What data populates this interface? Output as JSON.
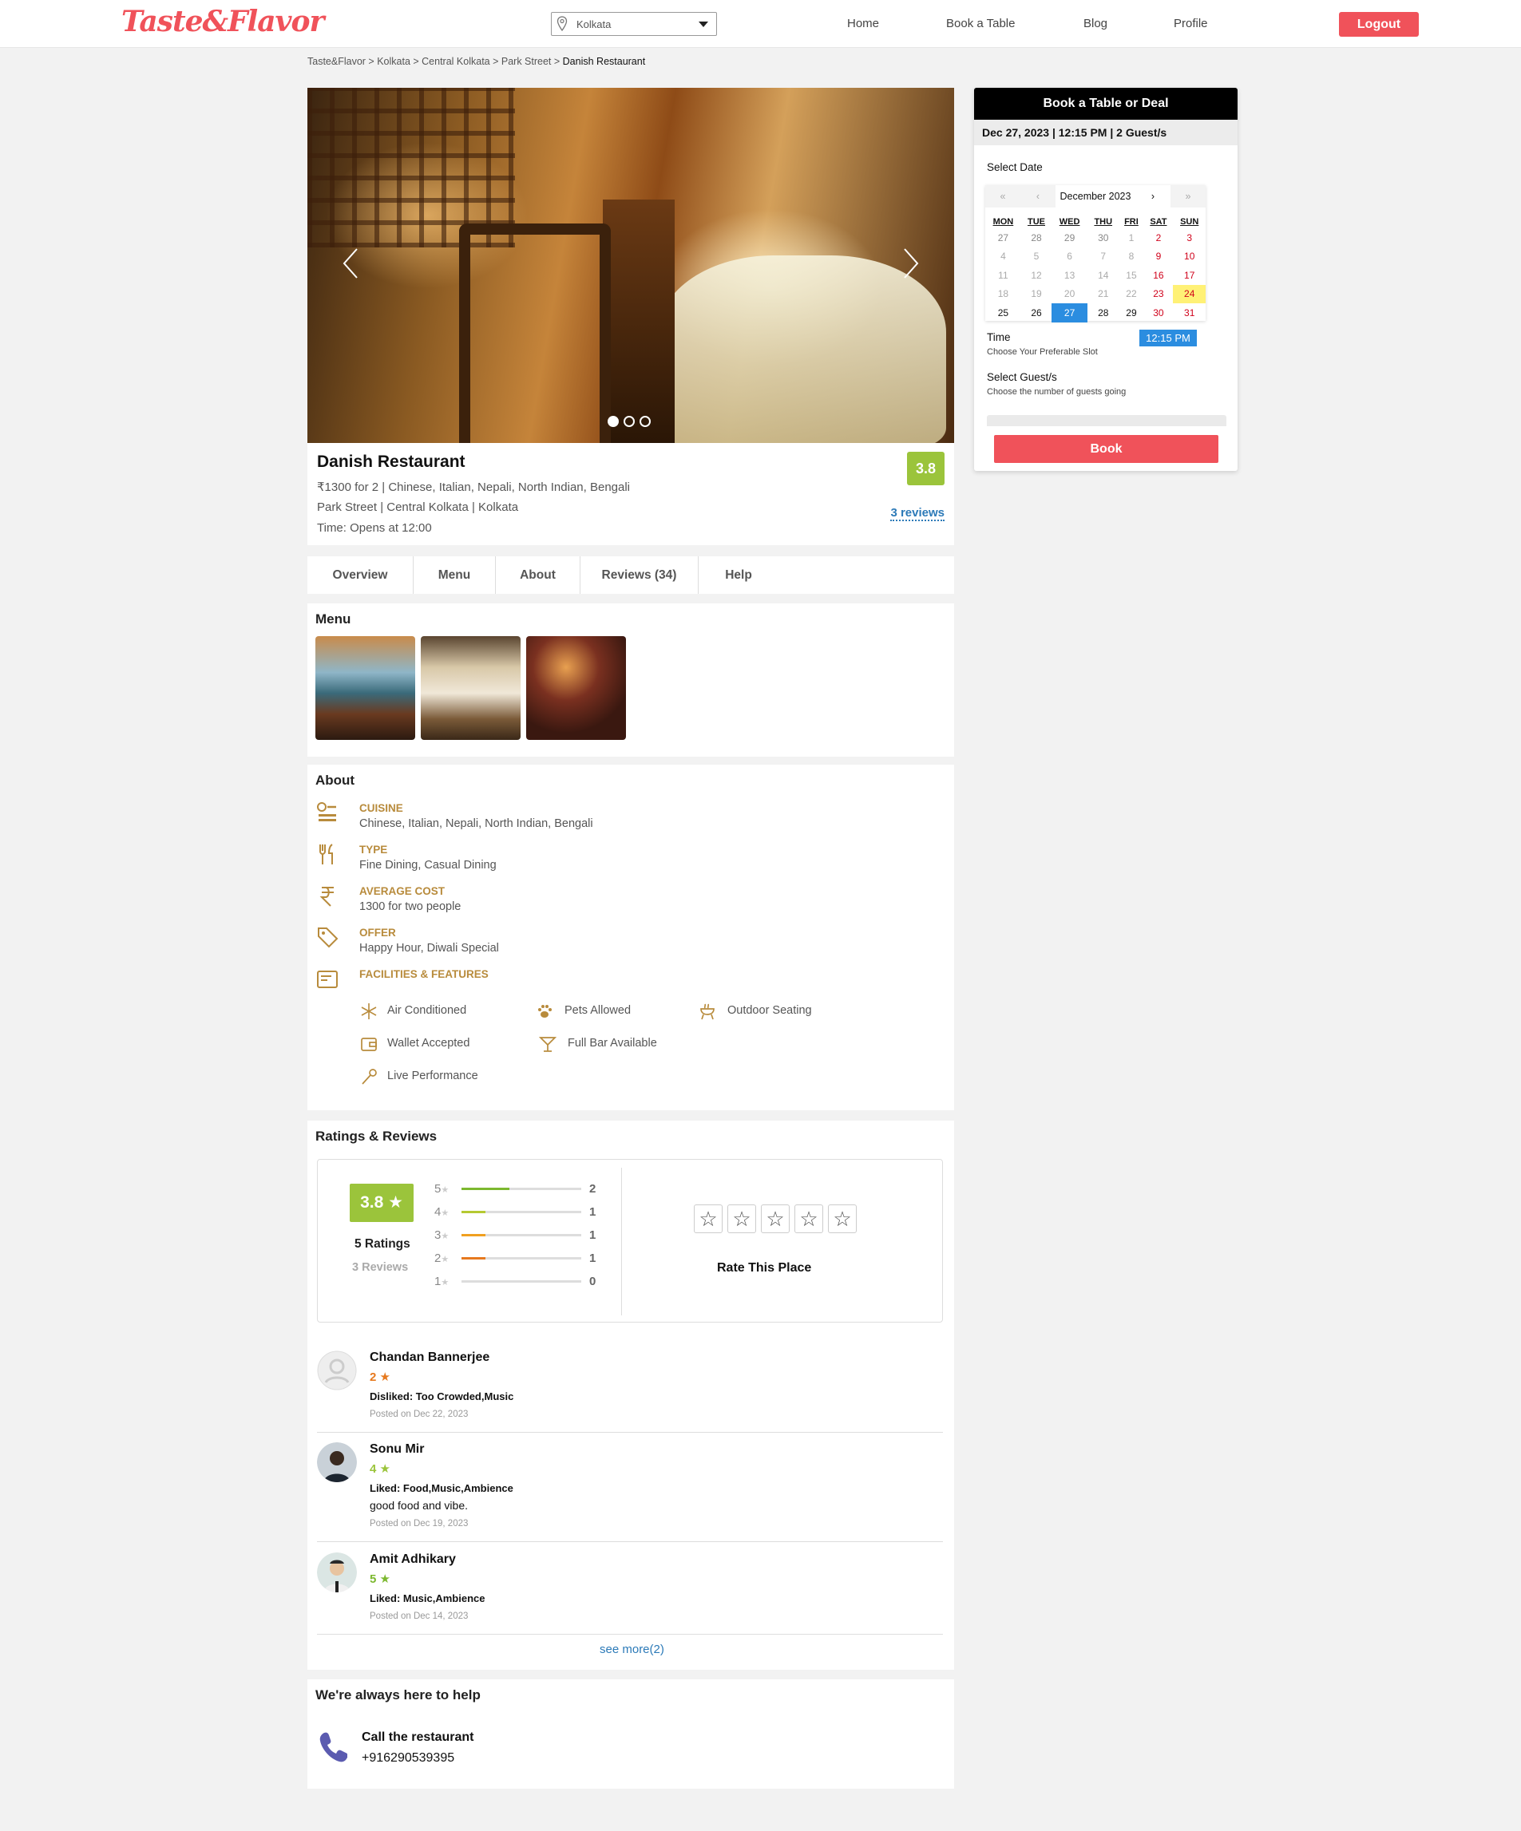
{
  "header": {
    "logo": "Taste&Flavor",
    "location": "Kolkata",
    "nav": [
      "Home",
      "Book a Table",
      "Blog",
      "Profile"
    ],
    "logout": "Logout"
  },
  "breadcrumb": [
    "Taste&Flavor",
    "Kolkata",
    "Central Kolkata",
    "Park Street",
    "Danish Restaurant"
  ],
  "carousel": {
    "slides": 3,
    "active": 0
  },
  "restaurant": {
    "name": "Danish Restaurant",
    "price_cuisine": "₹1300 for 2 | Chinese, Italian, Nepali, North Indian, Bengali",
    "address": "Park Street | Central Kolkata | Kolkata",
    "time": "Time: Opens at 12:00",
    "rating": "3.8",
    "reviews_link": "3 reviews"
  },
  "tabs": [
    "Overview",
    "Menu",
    "About",
    "Reviews (34)",
    "Help"
  ],
  "menu": {
    "title": "Menu"
  },
  "about": {
    "title": "About",
    "items": [
      {
        "label": "CUISINE",
        "value": "Chinese, Italian, Nepali, North Indian, Bengali"
      },
      {
        "label": "TYPE",
        "value": "Fine Dining, Casual Dining"
      },
      {
        "label": "AVERAGE COST",
        "value": "1300 for two people"
      },
      {
        "label": "OFFER",
        "value": "Happy Hour, Diwali Special"
      },
      {
        "label": "FACILITIES & FEATURES",
        "value": ""
      }
    ],
    "features": [
      "Air Conditioned",
      "Pets Allowed",
      "Outdoor Seating",
      "Wallet Accepted",
      "Full Bar Available",
      "Live Performance"
    ]
  },
  "ratings": {
    "title": "Ratings & Reviews",
    "score": "3.8 ★",
    "ratings_count": "5 Ratings",
    "reviews_count": "3 Reviews",
    "bars": [
      {
        "star": "5",
        "count": "2",
        "fraction": 0.4,
        "color": "#7cb82f"
      },
      {
        "star": "4",
        "count": "1",
        "fraction": 0.2,
        "color": "#b5c931"
      },
      {
        "star": "3",
        "count": "1",
        "fraction": 0.2,
        "color": "#f0a020"
      },
      {
        "star": "2",
        "count": "1",
        "fraction": 0.2,
        "color": "#e6791e"
      },
      {
        "star": "1",
        "count": "0",
        "fraction": 0,
        "color": "#e05050"
      }
    ],
    "rate_label": "Rate This Place"
  },
  "reviews": [
    {
      "name": "Chandan Bannerjee",
      "stars": "2 ★",
      "star_color": "#e6791e",
      "liked": "Disliked: Too Crowded,Music",
      "text": "",
      "date": "Posted on Dec 22, 2023"
    },
    {
      "name": "Sonu Mir",
      "stars": "4 ★",
      "star_color": "#9bc43b",
      "liked": "Liked: Food,Music,Ambience",
      "text": "good food and vibe.",
      "date": "Posted on Dec 19, 2023"
    },
    {
      "name": "Amit Adhikary",
      "stars": "5 ★",
      "star_color": "#7cb82f",
      "liked": "Liked: Music,Ambience",
      "text": "",
      "date": "Posted on Dec 14, 2023"
    }
  ],
  "see_more": "see more(2)",
  "help": {
    "title": "We're always here to help",
    "call_label": "Call the restaurant",
    "phone": "+916290539395"
  },
  "booking": {
    "title": "Book a Table or Deal",
    "summary": "Dec 27, 2023 | 12:15 PM | 2 Guest/s",
    "select_date": "Select Date",
    "calendar": {
      "month": "December 2023",
      "prev2": "«",
      "prev": "‹",
      "next": "›",
      "next2": "»",
      "weekdays": [
        "MON",
        "TUE",
        "WED",
        "THU",
        "FRI",
        "SAT",
        "SUN"
      ],
      "weeks": [
        [
          "27",
          "28",
          "29",
          "30",
          "1",
          "2",
          "3"
        ],
        [
          "4",
          "5",
          "6",
          "7",
          "8",
          "9",
          "10"
        ],
        [
          "11",
          "12",
          "13",
          "14",
          "15",
          "16",
          "17"
        ],
        [
          "18",
          "19",
          "20",
          "21",
          "22",
          "23",
          "24"
        ],
        [
          "25",
          "26",
          "27",
          "28",
          "29",
          "30",
          "31"
        ]
      ]
    },
    "time_label": "Time",
    "time_sub": "Choose Your Preferable Slot",
    "time_value": "12:15 PM",
    "guest_label": "Select Guest/s",
    "guest_sub": "Choose the number of guests going",
    "book_button": "Book"
  }
}
